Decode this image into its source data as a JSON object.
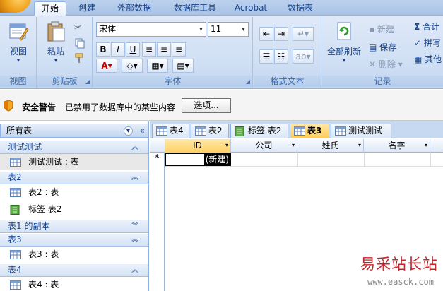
{
  "ribbon_tabs": [
    "开始",
    "创建",
    "外部数据",
    "数据库工具",
    "Acrobat",
    "数据表"
  ],
  "groups": {
    "view": {
      "label": "视图",
      "button": "视图"
    },
    "clipboard": {
      "label": "剪贴板",
      "paste": "粘贴"
    },
    "font": {
      "label": "字体",
      "font_name": "宋体",
      "font_size": "11"
    },
    "richtext": {
      "label": "格式文本"
    },
    "records": {
      "label": "记录",
      "refresh_all": "全部刷新",
      "new": "新建",
      "save": "保存",
      "delete": "删除",
      "totals": "合计",
      "spelling": "拼写",
      "more": "其他"
    }
  },
  "security": {
    "title": "安全警告",
    "message": "已禁用了数据库中的某些内容",
    "options_button": "选项..."
  },
  "nav": {
    "header": "所有表",
    "groups": [
      {
        "name": "测试测试",
        "items": [
          "测试测试 : 表"
        ]
      },
      {
        "name": "表2",
        "items": [
          "表2 : 表",
          "标签 表2"
        ]
      },
      {
        "name": "表1 的副本",
        "items": []
      },
      {
        "name": "表3",
        "items": [
          "表3 : 表"
        ]
      },
      {
        "name": "表4",
        "items": [
          "表4 : 表"
        ]
      }
    ]
  },
  "doc_tabs": [
    "表4",
    "表2",
    "标签 表2",
    "表3",
    "测试测试"
  ],
  "sheet": {
    "columns": [
      "ID",
      "公司",
      "姓氏",
      "名字"
    ],
    "new_row_marker": "*",
    "new_cell": "(新建)"
  },
  "watermark": {
    "text": "易采站长站",
    "url": "www.easck.com"
  },
  "colors": {
    "accent": "#15428b",
    "active_tab": "#ffcb57",
    "ribbon": "#d1e0f4"
  },
  "icons": [
    "office-button-icon",
    "view-icon",
    "paste-icon",
    "cut-icon",
    "copy-icon",
    "format-painter-icon",
    "refresh-icon",
    "shield-icon",
    "table-icon",
    "report-icon",
    "chevron-up-icon",
    "chevron-down-icon",
    "sigma-icon"
  ]
}
